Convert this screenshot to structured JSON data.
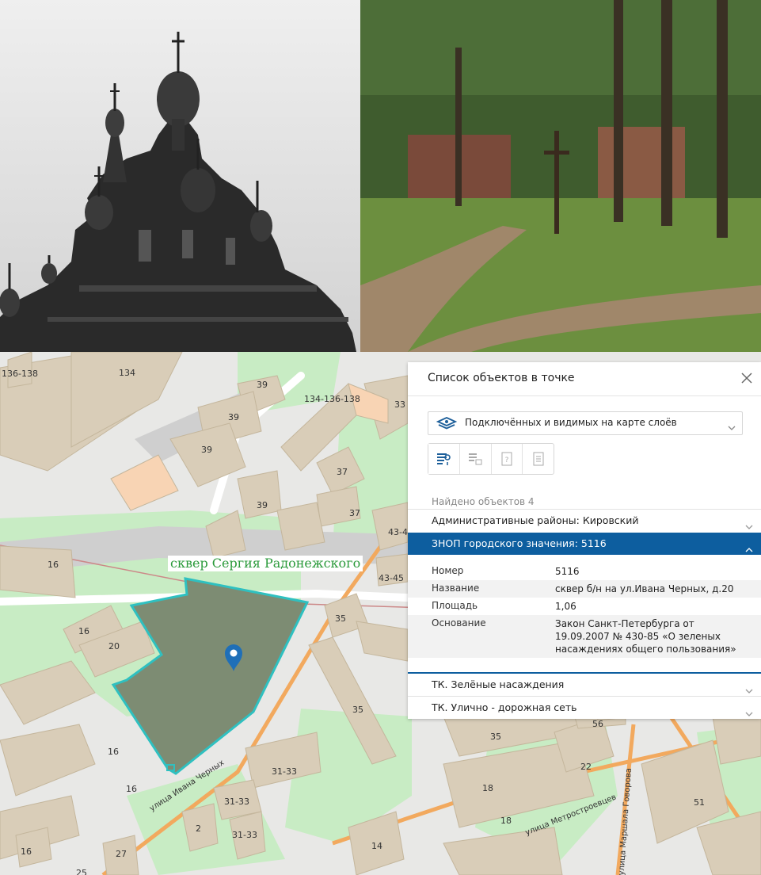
{
  "map_labels": {
    "b_136_138": "136-138",
    "b_134": "134",
    "b_39a": "39",
    "b_39b": "39",
    "b_39c": "39",
    "b_39d": "39",
    "b_134_136_138": "134-136-138",
    "b_33": "33",
    "b_37a": "37",
    "b_37b": "37",
    "b_43_4": "43-4",
    "b_43_45": "43-45",
    "b_16a": "16",
    "b_16b": "16",
    "b_16c": "16",
    "b_16d": "16",
    "b_16e": "16",
    "b_20": "20",
    "b_35a": "35",
    "b_35b": "35",
    "b_35c": "35",
    "b_56": "56",
    "b_22": "22",
    "b_18a": "18",
    "b_18b": "18",
    "b_31_33a": "31-33",
    "b_31_33b": "31-33",
    "b_31_33c": "31-33",
    "b_2": "2",
    "b_27": "27",
    "b_14": "14",
    "b_51": "51",
    "b_25": "25"
  },
  "streets": {
    "ivana_chernykh": "улица Ивана Черных",
    "metrostroevtsev": "улица Метростроевцев",
    "govorova": "улица Маршала Говорова"
  },
  "park_tag": "сквер Сергия Радонежского",
  "panel": {
    "title": "Список объектов в точке",
    "layer_select": "Подключённых и видимых на карте слоёв",
    "found": "Найдено объектов 4",
    "group_districts": "Административные районы: Кировский",
    "group_znop": "ЗНОП городского значения: 5116",
    "details": [
      {
        "key": "Номер",
        "value": "5116"
      },
      {
        "key": "Название",
        "value": "сквер б/н на ул.Ивана Черных, д.20"
      },
      {
        "key": "Площадь",
        "value": "1,06"
      },
      {
        "key": "Основание",
        "value": "Закон Санкт-Петербурга от 19.09.2007 № 430-85 «О зеленых насаждениях общего пользования»"
      }
    ],
    "group_green": "ТК. Зелёные насаждения",
    "group_roads": "ТК. Улично - дорожная сеть"
  },
  "colors": {
    "accent": "#0d5e9f",
    "park_fill": "#7d8c73",
    "park_stroke": "#2fc0c0",
    "building": "#d9cdb8",
    "green_area": "#c8ecc4",
    "road_major": "#f2a95e"
  },
  "icons": {
    "close": "close-icon",
    "layers": "layers-icon",
    "chevron": "chevron-down-icon",
    "pin": "map-pin-icon"
  }
}
